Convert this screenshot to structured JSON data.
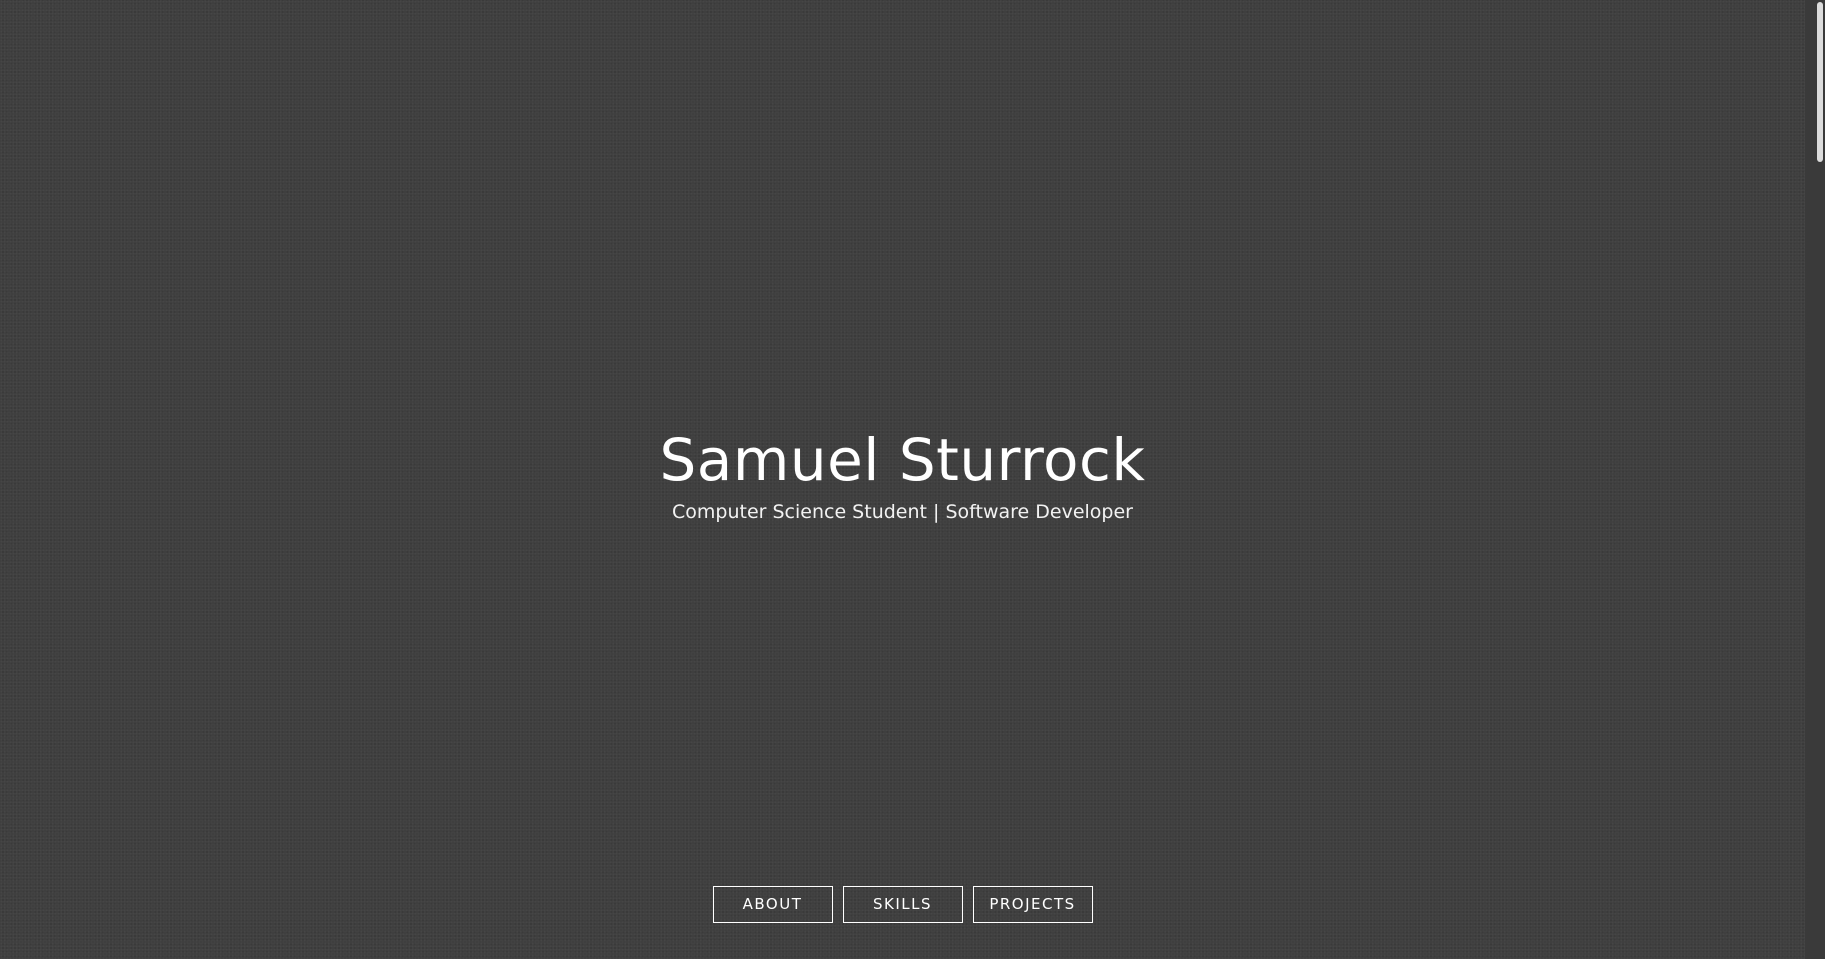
{
  "hero": {
    "title": "Samuel Sturrock",
    "subtitle": "Computer Science Student | Software Developer"
  },
  "nav": {
    "items": [
      {
        "label": "ABOUT"
      },
      {
        "label": "SKILLS"
      },
      {
        "label": "PROJECTS"
      }
    ]
  },
  "colors": {
    "background": "#3f3f3f",
    "text": "#ffffff",
    "button_border": "#ffffff"
  }
}
